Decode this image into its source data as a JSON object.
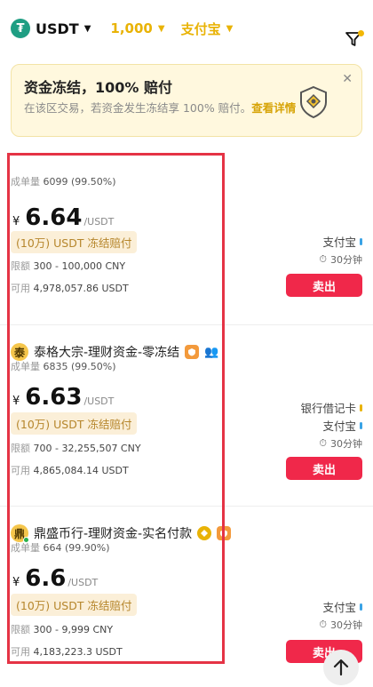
{
  "filters": {
    "coin": "USDT",
    "amount": "1,000",
    "payment": "支付宝"
  },
  "banner": {
    "title": "资金冻结，100% 赔付",
    "text": "在该区交易，若资金发生冻结享 100% 赔付。",
    "link": "查看详情"
  },
  "listings": [
    {
      "merchant": "",
      "orders_label": "成单量",
      "orders": "6099 (99.50%)",
      "currency": "¥",
      "price": "6.64",
      "unit": "/USDT",
      "guarantee": "(10万) USDT 冻结赔付",
      "limit_label": "限额",
      "limit": "300 - 100,000 CNY",
      "avail_label": "可用",
      "avail": "4,978,057.86 USDT",
      "payments": [
        "支付宝"
      ],
      "time": "30分钟",
      "button": "卖出"
    },
    {
      "merchant": "泰格大宗-理财资金-零冻结",
      "avatar": "泰",
      "orders_label": "成单量",
      "orders": "6835 (99.50%)",
      "currency": "¥",
      "price": "6.63",
      "unit": "/USDT",
      "guarantee": "(10万) USDT 冻结赔付",
      "limit_label": "限额",
      "limit": "700 - 32,255,507 CNY",
      "avail_label": "可用",
      "avail": "4,865,084.14 USDT",
      "payments": [
        "银行借记卡",
        "支付宝"
      ],
      "time": "30分钟",
      "button": "卖出"
    },
    {
      "merchant": "鼎盛币行-理财资金-实名付款",
      "avatar": "鼎",
      "orders_label": "成单量",
      "orders": "664 (99.90%)",
      "currency": "¥",
      "price": "6.6",
      "unit": "/USDT",
      "guarantee": "(10万) USDT 冻结赔付",
      "limit_label": "限额",
      "limit": "300 - 9,999 CNY",
      "avail_label": "可用",
      "avail": "4,183,223.3 USDT",
      "payments": [
        "支付宝"
      ],
      "time": "30分钟",
      "button": "卖出"
    }
  ],
  "colors": {
    "accent": "#e9b306",
    "sell": "#f0284a",
    "highlight": "#e53345"
  }
}
